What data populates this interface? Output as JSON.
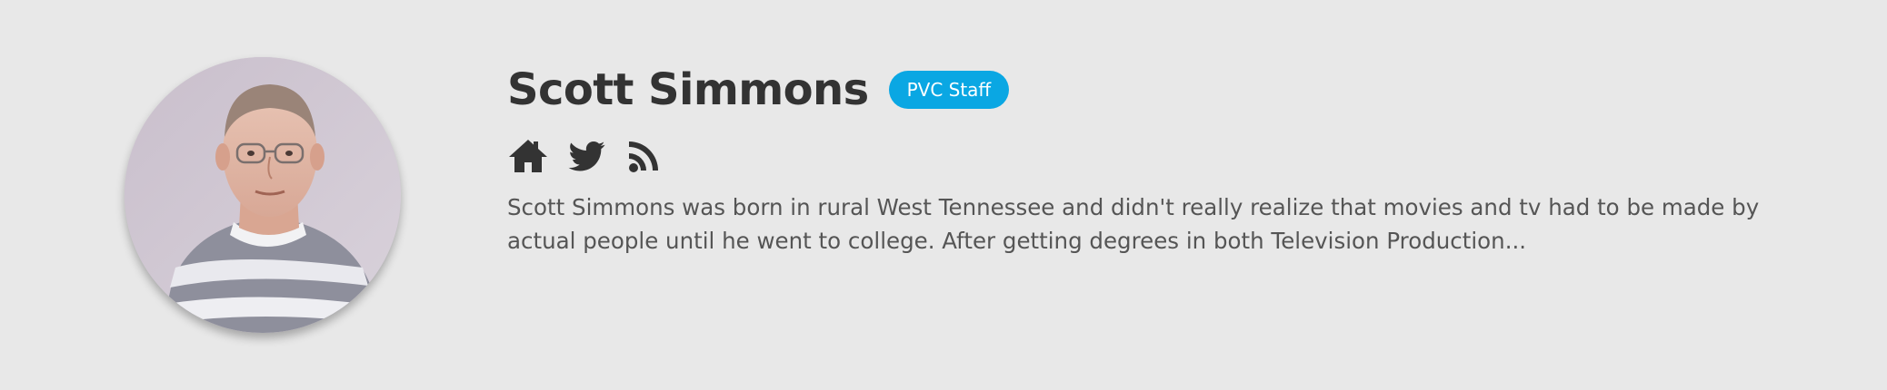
{
  "author": {
    "name": "Scott Simmons",
    "badge": "PVC Staff",
    "bio": "Scott Simmons was born in rural West Tennessee and didn't really realize that movies and tv had to be made by actual people until he went to college. After getting degrees in both Television Production..."
  },
  "social_links": [
    {
      "icon": "home-icon"
    },
    {
      "icon": "twitter-icon"
    },
    {
      "icon": "rss-icon"
    }
  ],
  "colors": {
    "background": "#e8e8e8",
    "name_text": "#333333",
    "bio_text": "#555555",
    "badge_background": "#0aa7e3",
    "badge_text": "#ffffff",
    "icon": "#333333"
  }
}
